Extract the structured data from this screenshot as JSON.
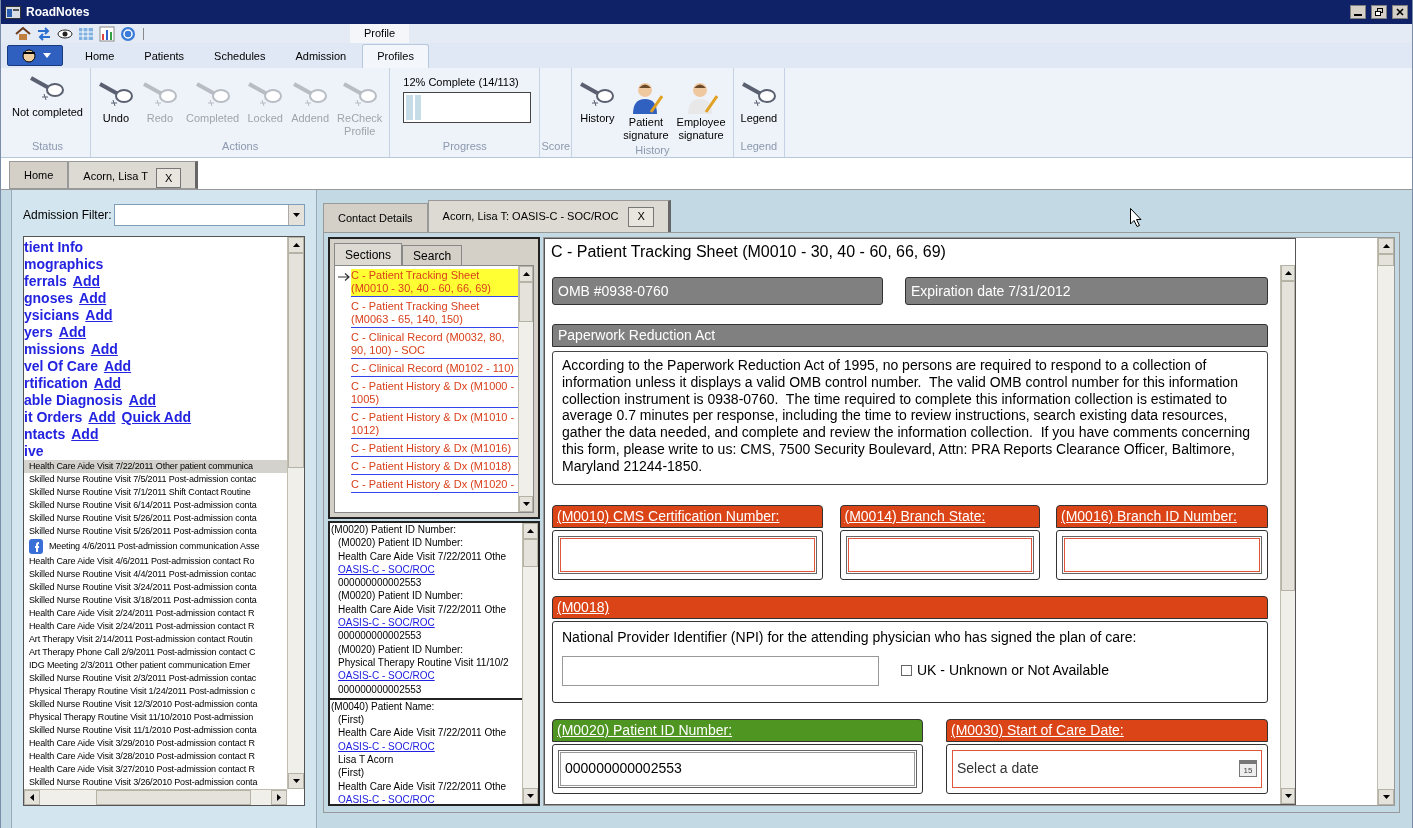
{
  "window": {
    "title": "RoadNotes"
  },
  "quick_access": {
    "contextual_header": "Profile"
  },
  "ribbon_tabs": [
    {
      "label": "Home",
      "selected": false
    },
    {
      "label": "Patients",
      "selected": false
    },
    {
      "label": "Schedules",
      "selected": false
    },
    {
      "label": "Admission",
      "selected": false
    },
    {
      "label": "Profiles",
      "selected": true
    }
  ],
  "ribbon_groups": [
    {
      "kind": "buttons",
      "label": "Status",
      "buttons": [
        {
          "label": "Not completed",
          "kind": "tool",
          "disabled": false
        }
      ]
    },
    {
      "kind": "buttons",
      "label": "Actions",
      "buttons": [
        {
          "label": "Undo",
          "kind": "tool",
          "disabled": false
        },
        {
          "label": "Redo",
          "kind": "tool",
          "disabled": true
        },
        {
          "label": "Completed",
          "kind": "tool",
          "disabled": true
        },
        {
          "label": "Locked",
          "kind": "tool",
          "disabled": true
        },
        {
          "label": "Addend",
          "kind": "tool",
          "disabled": true
        },
        {
          "label": "ReCheck\nProfile",
          "kind": "tool",
          "disabled": true
        }
      ]
    },
    {
      "kind": "progress",
      "label": "Progress",
      "caption": "12% Complete (14/113)",
      "level": 0.12
    },
    {
      "kind": "empty",
      "label": "Score"
    },
    {
      "kind": "buttons",
      "label": "History",
      "buttons": [
        {
          "label": "History",
          "kind": "tool",
          "disabled": false
        },
        {
          "label": "Patient\nsignature",
          "kind": "signature",
          "disabled": false
        },
        {
          "label": "Employee\nsignature",
          "kind": "signature",
          "disabled": false
        }
      ]
    },
    {
      "kind": "buttons",
      "label": "Legend",
      "buttons": [
        {
          "label": "Legend",
          "kind": "tool",
          "disabled": false
        }
      ]
    }
  ],
  "doc_tabs": [
    {
      "label": "Home",
      "selected": false
    },
    {
      "label": "Acorn, Lisa T",
      "selected": true,
      "close_label": "X"
    }
  ],
  "left_panel": {
    "filter_label": "Admission Filter:",
    "nav": [
      {
        "label": "tient Info"
      },
      {
        "label": "mographics"
      },
      {
        "label": "ferrals",
        "links": [
          "Add"
        ]
      },
      {
        "label": "gnoses",
        "links": [
          "Add"
        ]
      },
      {
        "label": "ysicians",
        "links": [
          "Add"
        ]
      },
      {
        "label": "yers",
        "links": [
          "Add"
        ]
      },
      {
        "label": "missions",
        "links": [
          "Add"
        ]
      },
      {
        "label": "vel Of Care",
        "links": [
          "Add"
        ]
      },
      {
        "label": "rtification",
        "links": [
          "Add"
        ]
      },
      {
        "label": "able Diagnosis",
        "links": [
          "Add"
        ]
      },
      {
        "label": "it Orders",
        "links": [
          "Add",
          "Quick Add"
        ]
      },
      {
        "label": "ntacts",
        "links": [
          "Add"
        ]
      },
      {
        "label": "ive"
      }
    ],
    "visits": [
      {
        "kind": "visit",
        "text": "Health Care Aide Visit 7/22/2011 Other patient communica",
        "selected": true
      },
      {
        "kind": "visit",
        "text": "Skilled Nurse Routine Visit 7/5/2011 Post-admission contac",
        "selected": false
      },
      {
        "kind": "visit",
        "text": "Skilled Nurse Routine Visit 7/1/2011 Shift Contact Routine",
        "selected": false
      },
      {
        "kind": "visit",
        "text": "Skilled Nurse Routine Visit 6/14/2011 Post-admission conta",
        "selected": false
      },
      {
        "kind": "visit",
        "text": "Skilled Nurse Routine Visit 5/26/2011 Post-admission conta",
        "selected": false
      },
      {
        "kind": "visit",
        "text": "Skilled Nurse Routine Visit 5/26/2011 Post-admission conta",
        "selected": false
      },
      {
        "kind": "meeting",
        "text": "Meeting 4/6/2011 Post-admission communication Asse",
        "selected": false
      },
      {
        "kind": "visit",
        "text": "Health Care Aide Visit 4/6/2011 Post-admission contact Ro",
        "selected": false
      },
      {
        "kind": "visit",
        "text": "Skilled Nurse Routine Visit 4/4/2011 Post-admission contac",
        "selected": false
      },
      {
        "kind": "visit",
        "text": "Skilled Nurse Routine Visit 3/24/2011 Post-admission conta",
        "selected": false
      },
      {
        "kind": "visit",
        "text": "Skilled Nurse Routine Visit 3/18/2011 Post-admission conta",
        "selected": false
      },
      {
        "kind": "visit",
        "text": "Health Care Aide Visit 2/24/2011 Post-admission contact R",
        "selected": false
      },
      {
        "kind": "visit",
        "text": "Health Care Aide Visit 2/24/2011 Post-admission contact R",
        "selected": false
      },
      {
        "kind": "visit",
        "text": "Art Therapy Visit 2/14/2011 Post-admission contact Routin",
        "selected": false
      },
      {
        "kind": "visit",
        "text": "Art Therapy Phone Call 2/9/2011 Post-admission contact C",
        "selected": false
      },
      {
        "kind": "visit",
        "text": "IDG Meeting 2/3/2011 Other patient communication Emer",
        "selected": false
      },
      {
        "kind": "visit",
        "text": "Skilled Nurse Routine Visit 2/3/2011 Post-admission contac",
        "selected": false
      },
      {
        "kind": "visit",
        "text": "Physical Therapy Routine Visit 1/24/2011 Post-admission c",
        "selected": false
      },
      {
        "kind": "visit",
        "text": "Skilled Nurse Routine Visit 12/3/2010 Post-admission conta",
        "selected": false
      },
      {
        "kind": "visit",
        "text": "Physical Therapy Routine Visit 11/10/2010 Post-admission",
        "selected": false
      },
      {
        "kind": "visit",
        "text": "Skilled Nurse Routine Visit 11/1/2010 Post-admission conta",
        "selected": false
      },
      {
        "kind": "visit",
        "text": "Health Care Aide Visit 3/29/2010 Post-admission contact R",
        "selected": false
      },
      {
        "kind": "visit",
        "text": "Health Care Aide Visit 3/28/2010 Post-admission contact R",
        "selected": false
      },
      {
        "kind": "visit",
        "text": "Health Care Aide Visit 3/27/2010 Post-admission contact R",
        "selected": false
      },
      {
        "kind": "visit",
        "text": "Skilled Nurse Routine Visit 3/26/2010 Post-admission conta",
        "selected": false
      }
    ]
  },
  "content_tabs": [
    {
      "label": "Contact Details",
      "selected": false
    },
    {
      "label": "Acorn, Lisa T: OASIS-C - SOC/ROC",
      "selected": true,
      "close_label": "X"
    }
  ],
  "sections_panel": {
    "tabs": [
      {
        "label": "Sections",
        "selected": true
      },
      {
        "label": "Search",
        "selected": false
      }
    ],
    "items": [
      {
        "text": "C - Patient Tracking Sheet (M0010 - 30, 40 - 60, 66, 69)",
        "selected": true
      },
      {
        "text": "C - Patient Tracking Sheet (M0063 - 65, 140, 150)",
        "selected": false
      },
      {
        "text": "C - Clinical Record (M0032, 80, 90, 100) - SOC",
        "selected": false
      },
      {
        "text": "C - Clinical Record (M0102 - 110)",
        "selected": false
      },
      {
        "text": "C - Patient History & Dx (M1000 - 1005)",
        "selected": false
      },
      {
        "text": "C - Patient History & Dx (M1010 - 1012)",
        "selected": false
      },
      {
        "text": "C - Patient History & Dx (M1016)",
        "selected": false
      },
      {
        "text": "C - Patient History & Dx (M1018)",
        "selected": false
      },
      {
        "text": "C - Patient History & Dx (M1020 -",
        "selected": false
      }
    ]
  },
  "results_panel": {
    "groups": [
      {
        "lines": [
          {
            "kind": "title",
            "text": "(M0020) Patient ID Number:"
          },
          {
            "kind": "text",
            "text": "(M0020) Patient ID Number:"
          },
          {
            "kind": "text",
            "text": "Health Care Aide Visit 7/22/2011 Othe"
          },
          {
            "kind": "link",
            "text": "OASIS-C - SOC/ROC"
          },
          {
            "kind": "text",
            "text": "000000000002553"
          },
          {
            "kind": "text",
            "text": "(M0020) Patient ID Number:"
          },
          {
            "kind": "text",
            "text": "Health Care Aide Visit 7/22/2011 Othe"
          },
          {
            "kind": "link",
            "text": "OASIS-C - SOC/ROC"
          },
          {
            "kind": "text",
            "text": "000000000002553"
          },
          {
            "kind": "text",
            "text": "(M0020) Patient ID Number:"
          },
          {
            "kind": "text",
            "text": "Physical Therapy Routine Visit 11/10/2"
          },
          {
            "kind": "link",
            "text": "OASIS-C - SOC/ROC"
          },
          {
            "kind": "text",
            "text": "000000000002553"
          }
        ]
      },
      {
        "lines": [
          {
            "kind": "title",
            "text": "(M0040) Patient Name:"
          },
          {
            "kind": "text",
            "text": "(First)"
          },
          {
            "kind": "text",
            "text": "Health Care Aide Visit 7/22/2011 Othe"
          },
          {
            "kind": "link",
            "text": "OASIS-C - SOC/ROC"
          },
          {
            "kind": "text",
            "text": "Lisa T Acorn"
          },
          {
            "kind": "text",
            "text": "(First)"
          },
          {
            "kind": "text",
            "text": "Health Care Aide Visit 7/22/2011 Othe"
          },
          {
            "kind": "link",
            "text": "OASIS-C - SOC/ROC"
          }
        ]
      }
    ]
  },
  "form": {
    "title": "C - Patient Tracking Sheet (M0010 - 30, 40 - 60, 66, 69)",
    "info_boxes": [
      "OMB #0938-0760",
      "Expiration date 7/31/2012"
    ],
    "notice": {
      "title": "Paperwork Reduction Act",
      "body": "According to the Paperwork Reduction Act of 1995, no persons are required to respond to a collection of information unless it displays a valid OMB control number.  The valid OMB control number for this information collection instrument is 0938-0760.  The time required to complete this information collection is estimated to average 0.7 minutes per response, including the time to review instructions, search existing data resources, gather the data needed, and complete and review the information collection.  If you have comments concerning this form, please write to us: CMS, 7500 Security Boulevard, Attn: PRA Reports Clearance Officer, Baltimore, Maryland 21244-1850."
    },
    "field_rows": [
      [
        {
          "kind": "text",
          "label": "(M0010) CMS Certification Number:",
          "complete": false
        },
        {
          "kind": "text",
          "label": "(M0014) Branch State:",
          "complete": false
        },
        {
          "kind": "text",
          "label": "(M0016) Branch ID Number:",
          "complete": false
        }
      ],
      [
        {
          "kind": "npi",
          "label": "(M0018)",
          "complete": false,
          "prompt": "National Provider Identifier (NPI) for the attending physician who has signed the plan of care:",
          "option": {
            "label": "UK - Unknown or Not Available",
            "checked": false
          }
        }
      ],
      [
        {
          "kind": "text",
          "label": "(M0020) Patient ID Number:",
          "complete": true,
          "value": "000000000002553"
        },
        {
          "kind": "date",
          "label": "(M0030) Start of Care Date:",
          "complete": false,
          "placeholder": "Select a date",
          "icon_day": "15"
        }
      ]
    ]
  }
}
